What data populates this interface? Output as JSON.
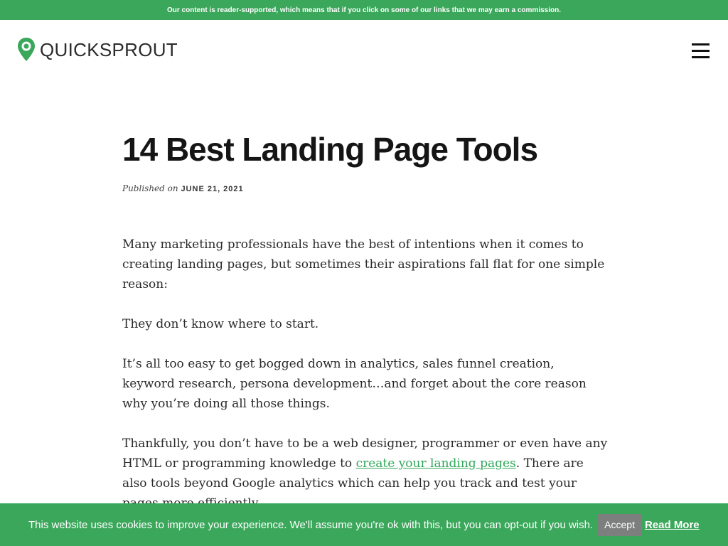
{
  "top_strip": {
    "text": "Our content is reader-supported, which means that if you click on some of our links that we may earn a commission."
  },
  "header": {
    "logo_text": "QUICKSPROUT",
    "logo_icon": "quicksprout-pin-icon",
    "menu_icon": "hamburger-menu-icon"
  },
  "article": {
    "title": "14 Best Landing Page Tools",
    "published_label": "Published on",
    "published_date": "JUNE 21, 2021",
    "paragraphs": [
      "Many marketing professionals have the best of intentions when it comes to creating landing pages, but sometimes their aspirations fall flat for one simple reason:",
      "They don’t know where to start.",
      "It’s all too easy to get bogged down in analytics, sales funnel creation, keyword research, persona development…and forget about the core reason why you’re doing all those things."
    ],
    "paragraph4": {
      "before_link": "Thankfully, you don’t have to be a web designer, programmer or even have any HTML or programming knowledge to ",
      "link_text": "create your landing pages",
      "after_link": ". There are also tools beyond Google analytics which can help you track and test your pages more efficiently."
    }
  },
  "cookie_banner": {
    "message": "This website uses cookies to improve your experience. We'll assume you're ok with this, but you can opt-out if you wish.",
    "accept_label": "Accept",
    "read_more_label": "Read More"
  },
  "colors": {
    "brand_green": "#3aa75a",
    "link_green": "#2fa85a",
    "accept_gray": "#7c7f7e"
  }
}
